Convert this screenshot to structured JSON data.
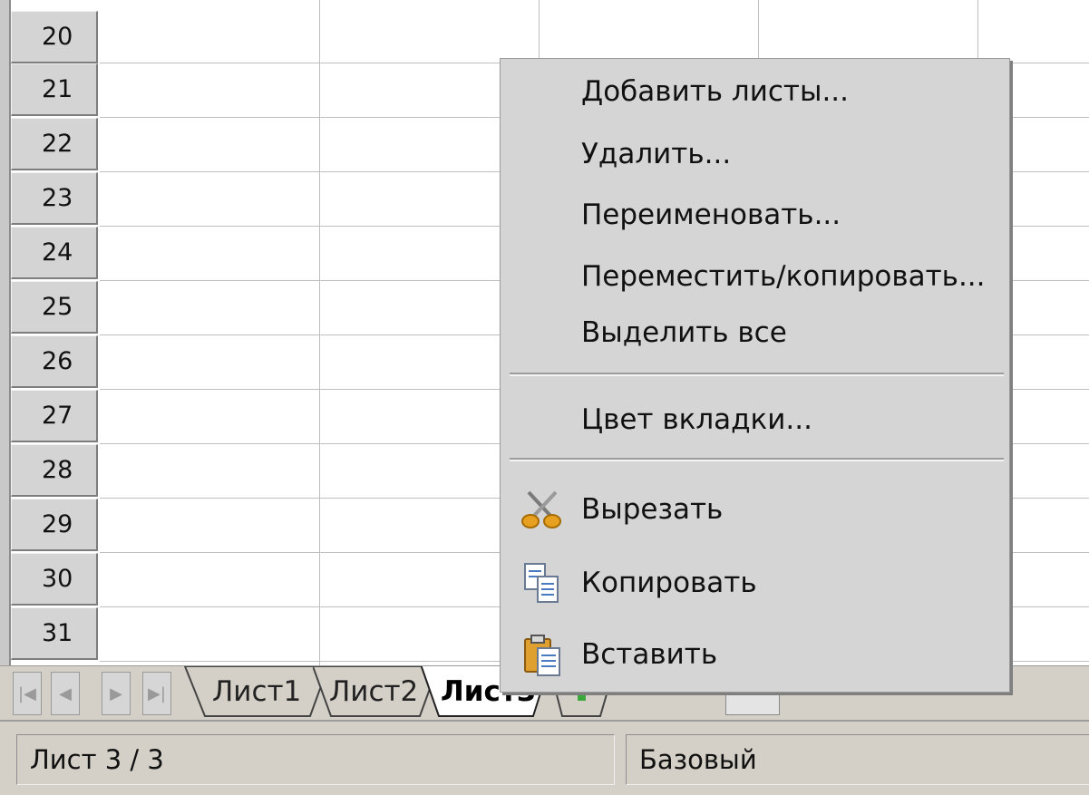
{
  "rows": [
    "20",
    "21",
    "22",
    "23",
    "24",
    "25",
    "26",
    "27",
    "28",
    "29",
    "30",
    "31"
  ],
  "context_menu": {
    "items": [
      {
        "label": "Добавить листы..."
      },
      {
        "label": "Удалить..."
      },
      {
        "label": "Переименовать..."
      },
      {
        "label": "Переместить/копировать..."
      },
      {
        "label": "Выделить все"
      },
      {
        "label": "Цвет вкладки..."
      },
      {
        "label": "Вырезать",
        "icon": "scissors-icon"
      },
      {
        "label": "Копировать",
        "icon": "copy-icon"
      },
      {
        "label": "Вставить",
        "icon": "paste-icon"
      }
    ]
  },
  "tabs": [
    {
      "label": "Лист1"
    },
    {
      "label": "Лист2"
    },
    {
      "label": "Лист3",
      "active": true
    }
  ],
  "nav_buttons": [
    "first-sheet-icon",
    "prev-sheet-icon",
    "next-sheet-icon",
    "last-sheet-icon"
  ],
  "status_bar": {
    "sheet_info": "Лист 3 / 3",
    "page_style": "Базовый"
  },
  "colors": {
    "menu_bg": "#d5d5d5",
    "chrome": "#d4d0c8",
    "add_tab_green": "#3aa83a"
  }
}
